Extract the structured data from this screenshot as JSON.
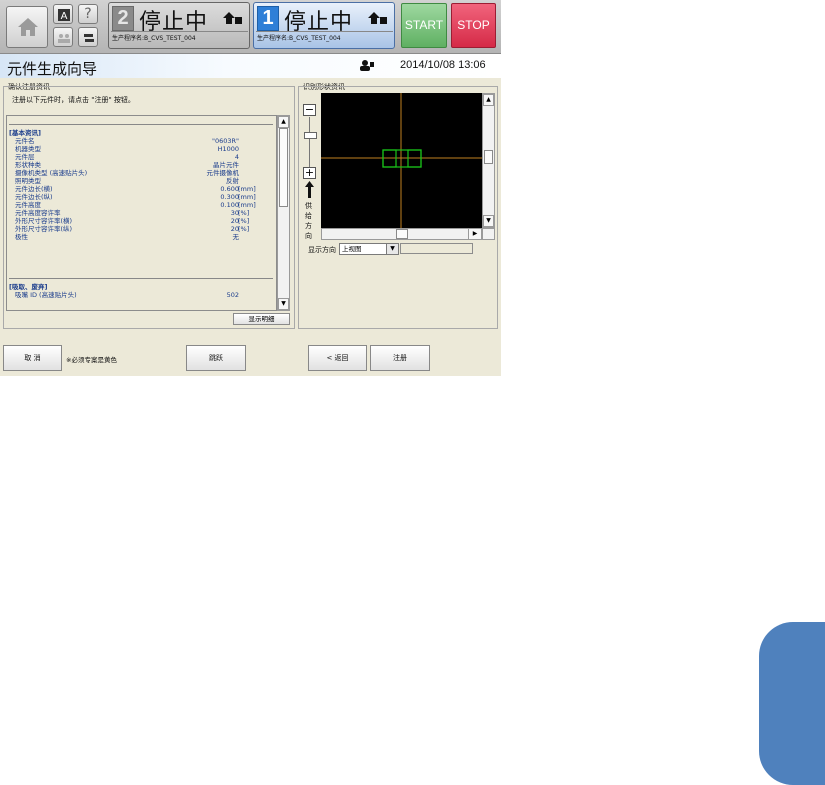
{
  "toolbar": {
    "home_icon": "home-icon",
    "small_icons": [
      "a-icon",
      "help-icon",
      "people-icon",
      "switch-icon"
    ],
    "help_label": "?"
  },
  "stations": [
    {
      "number": "2",
      "status": "停止中",
      "program": "生产程序名:B_CVS_TEST_004",
      "state": "inactive"
    },
    {
      "number": "1",
      "status": "停止中",
      "program": "生产程序名:B_CVS_TEST_004",
      "state": "active"
    }
  ],
  "controls": {
    "start_label": "START",
    "stop_label": "STOP",
    "start_color": "#6dbb70",
    "stop_color": "#e03a57"
  },
  "header": {
    "title": "元件生成向导",
    "datetime": "2014/10/08 13:06"
  },
  "confirm_panel": {
    "title": "确认注册资讯",
    "instruction": "注册以下元件时，请点击 \"注册\" 按钮。",
    "sections": [
      {
        "heading": "[基本资讯]",
        "rows": [
          {
            "label": "元件名",
            "value": "\"0603R\"",
            "unit": ""
          },
          {
            "label": "机器类型",
            "value": "H1000",
            "unit": ""
          },
          {
            "label": "元件层",
            "value": "4",
            "unit": ""
          },
          {
            "label": "形状种类",
            "value": "晶片元件",
            "unit": ""
          },
          {
            "label": "摄像机类型 (高速贴片头)",
            "value": "元件摄像机",
            "unit": ""
          },
          {
            "label": "照明类型",
            "value": "反射",
            "unit": ""
          },
          {
            "label": "元件边长(横)",
            "value": "0.600",
            "unit": "[mm]"
          },
          {
            "label": "元件边长(纵)",
            "value": "0.300",
            "unit": "[mm]"
          },
          {
            "label": "元件高度",
            "value": "0.100",
            "unit": "[mm]"
          },
          {
            "label": "元件高度容许率",
            "value": "30",
            "unit": "[%]"
          },
          {
            "label": "外形尺寸容许率(横)",
            "value": "20",
            "unit": "[%]"
          },
          {
            "label": "外形尺寸容许率(纵)",
            "value": "20",
            "unit": "[%]"
          },
          {
            "label": "极性",
            "value": "无",
            "unit": ""
          }
        ]
      },
      {
        "heading": "[吸取、废弃]",
        "rows": [
          {
            "label": "吸嘴 ID (高速贴片头)",
            "value": "502",
            "unit": ""
          }
        ]
      }
    ],
    "detail_button": "显示明细"
  },
  "shape_panel": {
    "title": "识别形状资讯",
    "supply_direction": "供给方向",
    "orientation_label": "显示方向",
    "orientation_value": "上视图",
    "zoom_in": "+",
    "zoom_out": "−"
  },
  "footer": {
    "cancel": "取 消",
    "note": "※必须专案是黄色",
    "skip": "跳跃",
    "back": "< 返回",
    "register": "注册"
  },
  "accent": {
    "side_tab_color": "#4f81bd"
  }
}
